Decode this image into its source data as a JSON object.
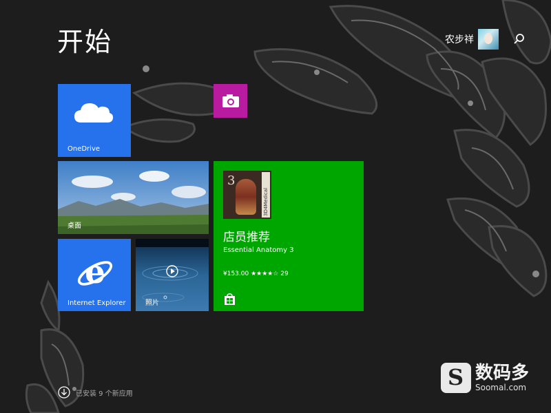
{
  "start_screen": {
    "title": "开始",
    "user_name": "农步祥",
    "avatar_icon": "user-avatar",
    "search_icon": "search-icon",
    "background_color": "#1d1d1d"
  },
  "tiles": {
    "onedrive": {
      "label": "OneDrive",
      "icon": "cloud-icon",
      "color": "#2672ec"
    },
    "camera": {
      "icon": "camera-icon",
      "color": "#b81b9f"
    },
    "desktop": {
      "label": "桌面",
      "icon": "landscape-image"
    },
    "internet_explorer": {
      "label": "Internet Explorer",
      "icon": "internet-explorer-icon",
      "color": "#2672ec"
    },
    "photos": {
      "label": "照片",
      "icon": "play-icon"
    },
    "store": {
      "heading": "店员推荐",
      "app_name": "Essential Anatomy 3",
      "meta": "¥153.00 ★★★★☆ 29",
      "icon": "store-bag-icon",
      "color": "#00a600",
      "thumb_number": "3",
      "thumb_side_text": "3D4Medical"
    }
  },
  "footer": {
    "installed_text": "已安装 9 个新应用",
    "installed_icon": "down-arrow-circle-icon"
  },
  "watermark": {
    "logo_letter": "S",
    "name_cn": "数码多",
    "name_en": "Soomal.com"
  }
}
